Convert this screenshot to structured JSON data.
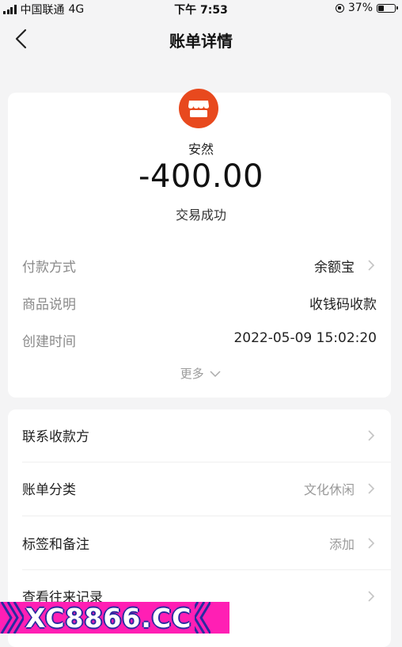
{
  "status_bar": {
    "carrier": "中国联通",
    "network": "4G",
    "time": "下午 7:53",
    "battery_percent_text": "37%",
    "battery_level": 0.37
  },
  "nav": {
    "title": "账单详情",
    "back_icon": "chevron-left-icon"
  },
  "summary": {
    "merchant_icon": "storefront-icon",
    "merchant_icon_color": "#e8491e",
    "name": "安然",
    "amount": "-400.00",
    "status": "交易成功"
  },
  "details": [
    {
      "label": "付款方式",
      "value": "余额宝"
    },
    {
      "label": "商品说明",
      "value": "收钱码收款"
    },
    {
      "label": "创建时间",
      "value": "2022-05-09 15:02:20"
    }
  ],
  "more_label": "更多",
  "actions": [
    {
      "label": "联系收款方",
      "value": ""
    },
    {
      "label": "账单分类",
      "value": "文化休闲"
    },
    {
      "label": "标签和备注",
      "value": "添加"
    },
    {
      "label": "查看往来记录",
      "value": ""
    }
  ],
  "watermark": {
    "text": "XC8866.CC",
    "color": "#ff1fb4"
  }
}
